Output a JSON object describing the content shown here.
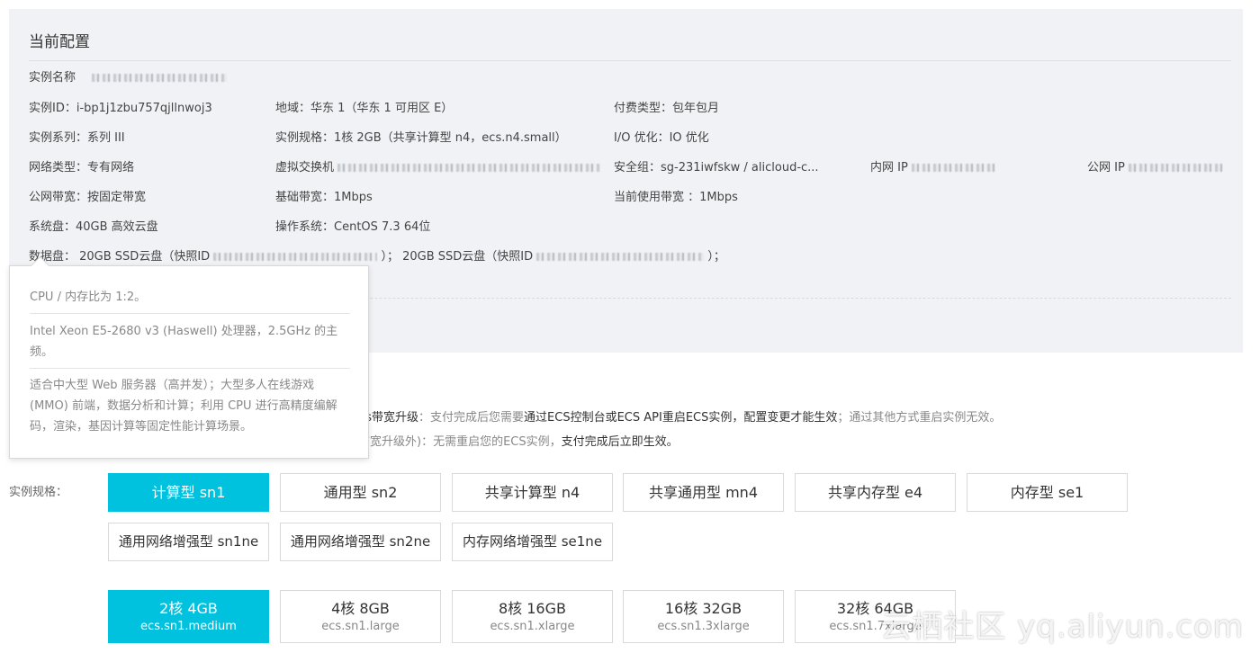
{
  "config": {
    "title": "当前配置",
    "instance_name_label": "实例名称",
    "instance_id": "实例ID：i-bp1j1zbu757qjllnwoj3",
    "region": "地域：华东 1（华东 1 可用区 E）",
    "billing": "付费类型：包年包月",
    "series": "实例系列：系列 III",
    "spec": "实例规格：1核 2GB（共享计算型 n4，ecs.n4.small）",
    "io": "I/O 优化：IO 优化",
    "network": "网络类型：专有网络",
    "vswitch_label": "虚拟交换机",
    "security_group": "安全组：sg-231iwfskw / alicloud-c...",
    "private_ip_label": "内网 IP",
    "public_ip_label": "公网 IP",
    "bandwidth": "公网带宽：按固定带宽",
    "base_bandwidth": "基础带宽：1Mbps",
    "current_bandwidth": "当前使用带宽 ：1Mbps",
    "system_disk": "系统盘：40GB 高效云盘",
    "os": "操作系统：CentOS 7.3 64位",
    "data_disk_label": "数据盘： 20GB SSD云盘（快照ID",
    "data_disk_mid": "）； 20GB SSD云盘（快照ID",
    "data_disk_end": "）；"
  },
  "tooltip": {
    "ratio": "CPU / 内存比为 1:2。",
    "processor": "Intel Xeon E5-2680 v3 (Haswell) 处理器，2.5GHz 的主频。",
    "usage": "适合中大型 Web 服务器（高并发）；大型多人在线游戏 (MMO) 前端，数据分析和计算；利用 CPU 进行高精度编解码，渲染，基因计算等固定性能计算场景。"
  },
  "notice": {
    "line1_a": "ps带宽升级",
    "line1_b": "：支付完成后您需要",
    "line1_c": "通过ECS控制台或ECS API重启ECS实例，配置变更才能生效",
    "line1_d": "；通过其他方式重启实例无效。",
    "line2_a": "带宽升级外)：无需重启您的ECS实例，",
    "line2_b": "支付完成后立即生效。"
  },
  "spec_label": "实例规格：",
  "families": [
    "计算型 sn1",
    "通用型 sn2",
    "共享计算型 n4",
    "共享通用型 mn4",
    "共享内存型 e4",
    "内存型 se1",
    "通用网络增强型 sn1ne",
    "通用网络增强型 sn2ne",
    "内存网络增强型 se1ne"
  ],
  "sizes": [
    {
      "main": "2核 4GB",
      "sub": "ecs.sn1.medium"
    },
    {
      "main": "4核 8GB",
      "sub": "ecs.sn1.large"
    },
    {
      "main": "8核 16GB",
      "sub": "ecs.sn1.xlarge"
    },
    {
      "main": "16核 32GB",
      "sub": "ecs.sn1.3xlarge"
    },
    {
      "main": "32核 64GB",
      "sub": "ecs.sn1.7xlarge"
    }
  ],
  "watermark": "云栖社区 yq.aliyun.com",
  "colors": {
    "accent": "#00c1de",
    "panel_bg": "#f0f2f5"
  }
}
